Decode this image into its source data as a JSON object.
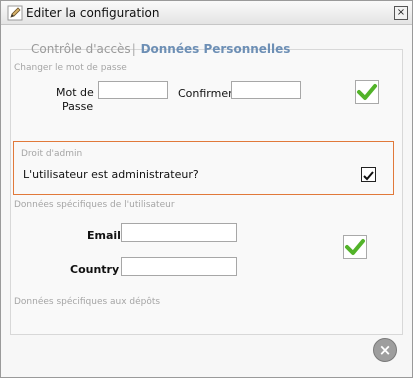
{
  "window": {
    "title": "Editer la configuration",
    "close_glyph": "×"
  },
  "tabs": {
    "access_label": "Contrôle d'accès",
    "separator": "|",
    "personal_label": "Données Personnelles"
  },
  "password": {
    "section_title": "Changer le mot de passe",
    "pwd_label_line1": "Mot de",
    "pwd_label_line2": "Passe",
    "confirm_label": "Confirmer",
    "pwd_value": "",
    "confirm_value": ""
  },
  "admin": {
    "section_title": "Droit d'admin",
    "question": "L'utilisateur est administrateur?",
    "checked": true
  },
  "user_data": {
    "section_title": "Données spécifiques de l'utilisateur",
    "email_label": "Email :",
    "country_label": "Country :",
    "email_value": "",
    "country_value": ""
  },
  "repo_data": {
    "section_title": "Données spécifiques aux dépôts"
  },
  "icons": {
    "title_icon": "pencil-icon",
    "save_icon": "checkmark-icon",
    "close_icon": "close-circle-icon"
  },
  "colors": {
    "active_tab": "#6d8fb5",
    "admin_border": "#e1793a",
    "check_green": "#52b329"
  }
}
